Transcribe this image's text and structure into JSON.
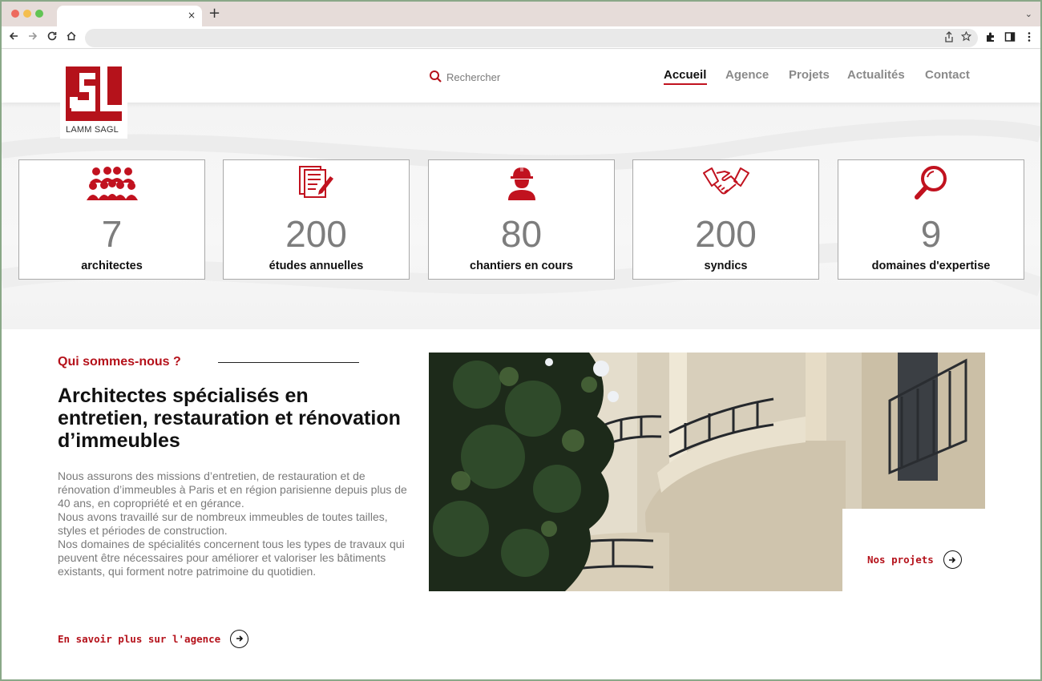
{
  "browser": {
    "tab_close": "×",
    "new_tab": "+",
    "tab_menu": "⌄",
    "icons": [
      "back-icon",
      "forward-icon",
      "reload-icon",
      "home-icon",
      "share-icon",
      "star-icon",
      "extensions-icon",
      "sidebar-icon",
      "more-icon"
    ]
  },
  "header": {
    "logo_text": "LAMM SAGL",
    "search_placeholder": "Rechercher",
    "nav": [
      {
        "label": "Accueil",
        "active": true
      },
      {
        "label": "Agence",
        "active": false
      },
      {
        "label": "Projets",
        "active": false
      },
      {
        "label": "Actualités",
        "active": false
      },
      {
        "label": "Contact",
        "active": false
      }
    ]
  },
  "stats": [
    {
      "icon": "team-icon",
      "number": "7",
      "label": "architectes"
    },
    {
      "icon": "documents-icon",
      "number": "200",
      "label": "études annuelles"
    },
    {
      "icon": "worker-helmet-icon",
      "number": "80",
      "label": "chantiers en cours"
    },
    {
      "icon": "handshake-icon",
      "number": "200",
      "label": "syndics"
    },
    {
      "icon": "magnifier-icon",
      "number": "9",
      "label": "domaines d'expertise"
    }
  ],
  "about": {
    "kicker": "Qui sommes-nous ?",
    "title": "Architectes spécialisés en entretien, restauration et rénovation d’immeubles",
    "paragraphs": [
      "Nous assurons des missions d’entretien, de restauration et de rénovation d’immeubles à Paris et en région parisienne depuis plus de 40 ans, en copropriété et en gérance.",
      "Nous avons travaillé sur de nombreux immeubles de toutes tailles, styles et périodes de construction.",
      "Nos domaines de spécialités concernent tous les types de travaux qui peuvent être nécessaires pour améliorer et valoriser les bâtiments existants, qui forment notre patrimoine du quotidien."
    ],
    "cta": "En savoir plus sur l'agence"
  },
  "projects": {
    "link": "Nos projets"
  },
  "colors": {
    "brand_red": "#b5121b",
    "text_dark": "#111111",
    "text_grey": "#7a7a7a",
    "nav_grey": "#8a8a8a"
  }
}
